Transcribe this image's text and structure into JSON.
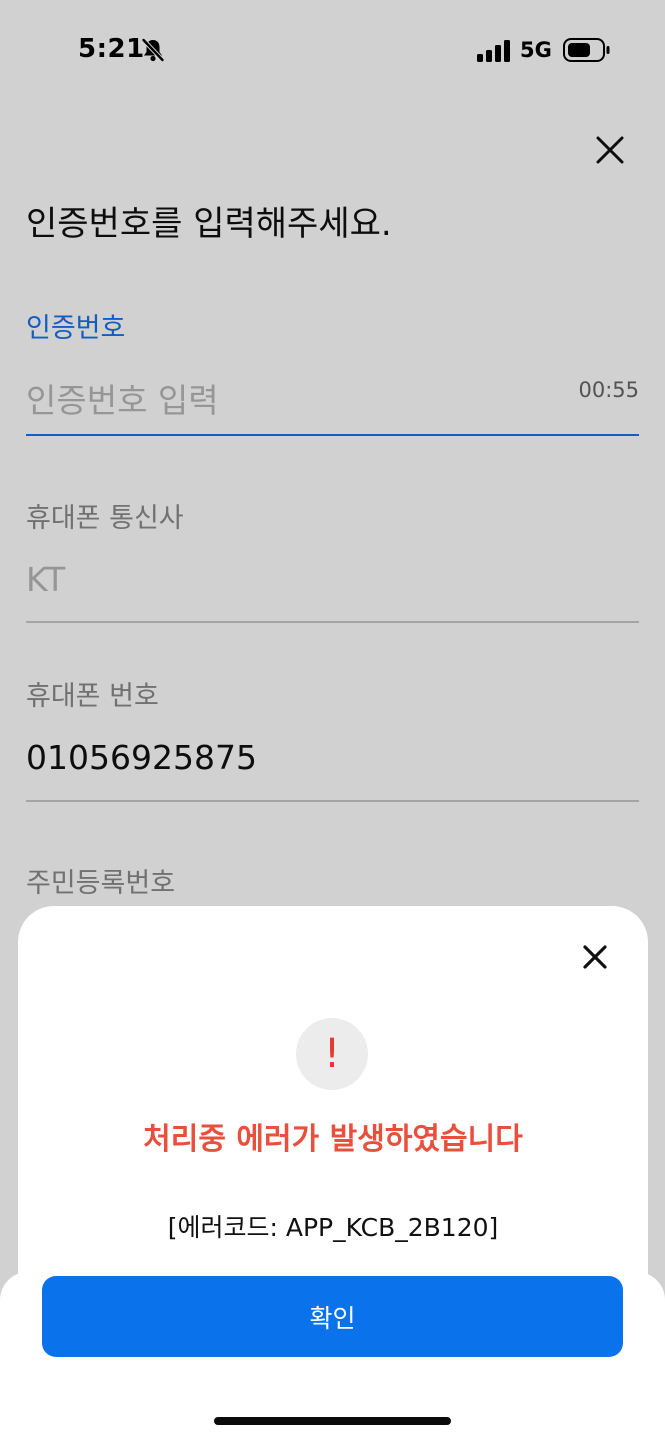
{
  "status_bar": {
    "time": "5:21",
    "network": "5G",
    "icons": [
      "bell-slash-icon",
      "signal-icon",
      "battery-icon"
    ]
  },
  "form": {
    "title": "인증번호를 입력해주세요.",
    "fields": [
      {
        "label": "인증번호",
        "placeholder": "인증번호 입력",
        "value": "",
        "timer": "00:55"
      },
      {
        "label": "휴대폰 통신사",
        "value": "KT"
      },
      {
        "label": "휴대폰 번호",
        "value": "01056925875"
      },
      {
        "label": "주민등록번호"
      }
    ]
  },
  "dialog": {
    "icon": "alert-icon",
    "alert_symbol": "!",
    "title": "처리중 에러가 발생하였습니다",
    "error_code": "[에러코드: APP_KCB_2B120]",
    "confirm_label": "확인"
  },
  "colors": {
    "accent": "#1a73e8",
    "button": "#0a73ec",
    "error": "#ea4f3d"
  }
}
